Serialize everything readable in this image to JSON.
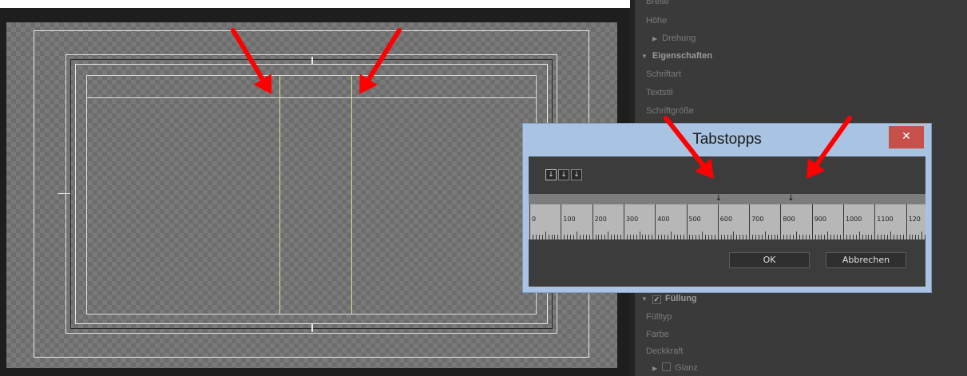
{
  "properties_panel": {
    "items": [
      {
        "label": "Breite",
        "type": "field"
      },
      {
        "label": "Höhe",
        "type": "field"
      },
      {
        "label": "Drehung",
        "type": "subgroup"
      },
      {
        "label": "Eigenschaften",
        "type": "section"
      },
      {
        "label": "Schriftart",
        "type": "field"
      },
      {
        "label": "Textstil",
        "type": "field"
      },
      {
        "label": "Schriftgröße",
        "type": "field"
      }
    ],
    "lower_items": [
      {
        "label": "Füllung",
        "type": "section-check"
      },
      {
        "label": "Fülltyp",
        "type": "field"
      },
      {
        "label": "Farbe",
        "type": "field"
      },
      {
        "label": "Deckkraft",
        "type": "field"
      },
      {
        "label": "Glanz",
        "type": "subgroup-check"
      }
    ]
  },
  "dialog": {
    "title": "Tabstopps",
    "close_icon": "close-icon",
    "alignment_buttons": [
      "tab-left-icon",
      "tab-center-icon",
      "tab-right-icon"
    ],
    "ruler": {
      "labels": [
        "0",
        "100",
        "200",
        "300",
        "400",
        "500",
        "600",
        "700",
        "800",
        "900",
        "1000",
        "1100",
        "120"
      ]
    },
    "tab_stops": [
      600,
      830
    ],
    "ok_label": "OK",
    "cancel_label": "Abbrechen"
  },
  "colors": {
    "annotation_arrow": "#ff0000",
    "tab_guide": "#e6e08a",
    "dialog_frame": "#a9c4e2",
    "close_button": "#c7504a"
  }
}
